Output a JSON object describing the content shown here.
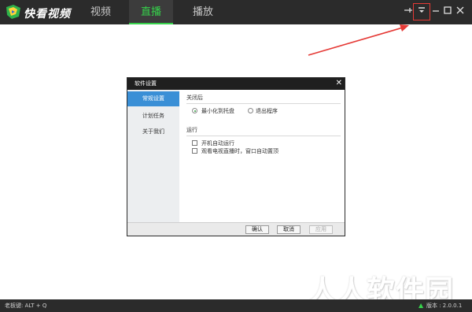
{
  "app": {
    "name": "快看视频"
  },
  "nav": {
    "tabs": [
      {
        "label": "视频"
      },
      {
        "label": "直播",
        "active": true
      },
      {
        "label": "播放"
      }
    ]
  },
  "window_controls": {
    "icons": [
      "pin-icon",
      "dropdown-menu-icon",
      "minimize-icon",
      "maximize-icon",
      "close-icon"
    ]
  },
  "dialog": {
    "title": "软件设置",
    "sidebar": [
      {
        "label": "常规设置",
        "active": true
      },
      {
        "label": "计划任务"
      },
      {
        "label": "关于我们"
      }
    ],
    "sections": {
      "close": {
        "title": "关闭后",
        "options": [
          {
            "label": "最小化到托盘",
            "selected": true
          },
          {
            "label": "退出程序",
            "selected": false
          }
        ]
      },
      "run": {
        "title": "运行",
        "options": [
          {
            "label": "开机自动运行",
            "checked": false
          },
          {
            "label": "观看电视直播时，窗口自动置顶",
            "checked": false
          }
        ]
      }
    },
    "buttons": {
      "ok": "确认",
      "cancel": "取消",
      "apply": "应用"
    }
  },
  "status": {
    "hotkey": "老板键: ALT + Q",
    "version": "版本 : 2.0.0.1"
  },
  "watermark": "人人软件园",
  "colors": {
    "accent": "#36d24b",
    "dialog_selected": "#3a8fd6",
    "annotation": "#e53935"
  }
}
